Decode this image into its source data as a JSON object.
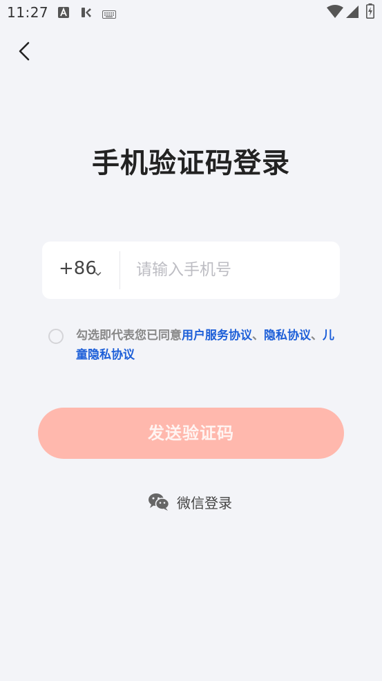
{
  "status_bar": {
    "time": "11:27",
    "left_icons": [
      "a-badge-icon",
      "k-badge-icon",
      "keyboard-icon"
    ],
    "right_icons": [
      "wifi-icon",
      "signal-icon",
      "battery-charging-icon"
    ]
  },
  "header": {
    "back_icon": "chevron-left-icon"
  },
  "title": "手机验证码登录",
  "phone": {
    "country_code": "+86",
    "placeholder": "请输入手机号",
    "value": ""
  },
  "agreement": {
    "prefix": "勾选即代表您已同意",
    "link_user": "用户服务协议",
    "sep1": "、",
    "link_privacy": "隐私协议",
    "sep2": "、",
    "link_child": "儿童隐私协议",
    "checked": false
  },
  "send_button": {
    "label": "发送验证码"
  },
  "wechat": {
    "label": "微信登录",
    "icon": "wechat-icon"
  },
  "colors": {
    "background": "#f3f4f8",
    "accent_disabled": "#ffb8ad",
    "link": "#1d5fd8"
  }
}
